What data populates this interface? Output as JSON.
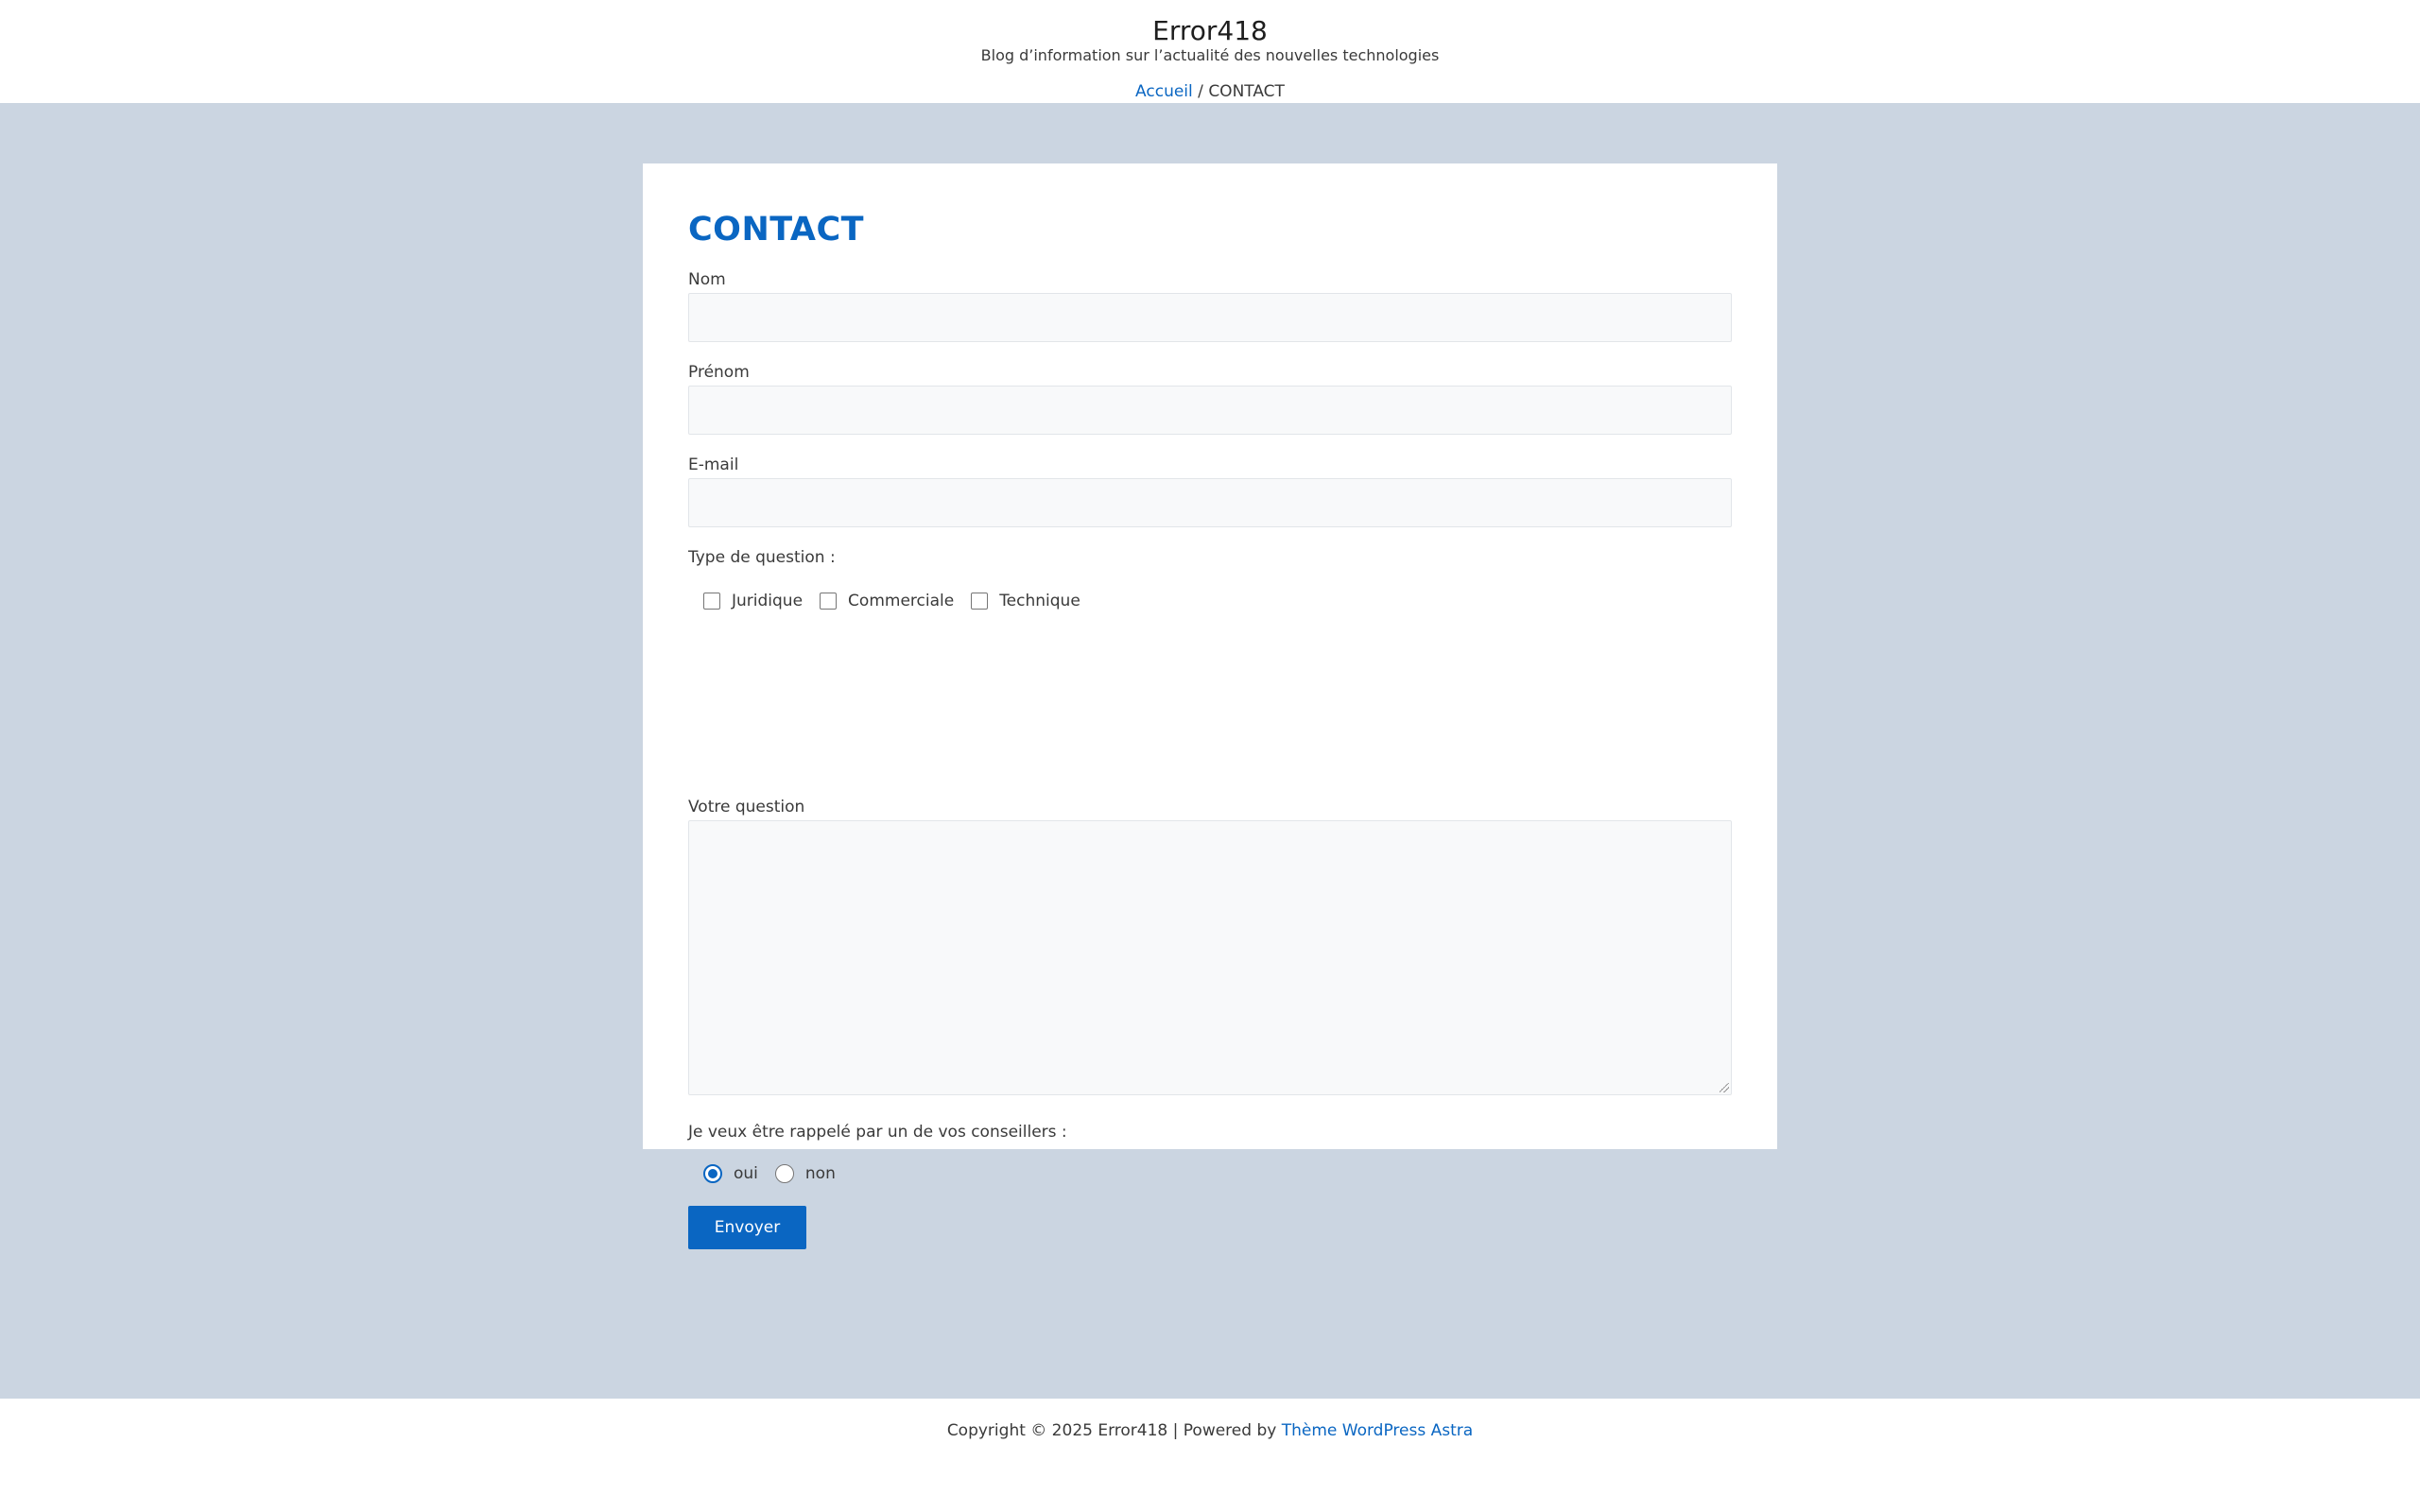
{
  "site": {
    "title": "Error418",
    "tagline": "Blog d’information sur l’actualité des nouvelles technologies"
  },
  "breadcrumb": {
    "home": "Accueil",
    "separator": " / ",
    "current": "CONTACT"
  },
  "page": {
    "title": "CONTACT"
  },
  "form": {
    "nom_label": "Nom",
    "nom_value": "",
    "prenom_label": "Prénom",
    "prenom_value": "",
    "email_label": "E-mail",
    "email_value": "",
    "question_type_label": "Type de question :",
    "question_types": [
      {
        "label": "Juridique",
        "checked": false
      },
      {
        "label": "Commerciale",
        "checked": false
      },
      {
        "label": "Technique",
        "checked": false
      }
    ],
    "question_label": "Votre question",
    "question_value": "",
    "callback_label": "Je veux être rappelé par un de vos conseillers :",
    "callback_options": [
      {
        "label": "oui",
        "checked": true
      },
      {
        "label": "non",
        "checked": false
      }
    ],
    "submit_label": "Envoyer"
  },
  "footer": {
    "copyright": "Copyright © 2025 Error418 | Powered by ",
    "theme_link": "Thème WordPress Astra"
  },
  "colors": {
    "accent": "#0a66c2",
    "page_background": "#cbd5e1",
    "field_background": "#f8f9fa"
  }
}
